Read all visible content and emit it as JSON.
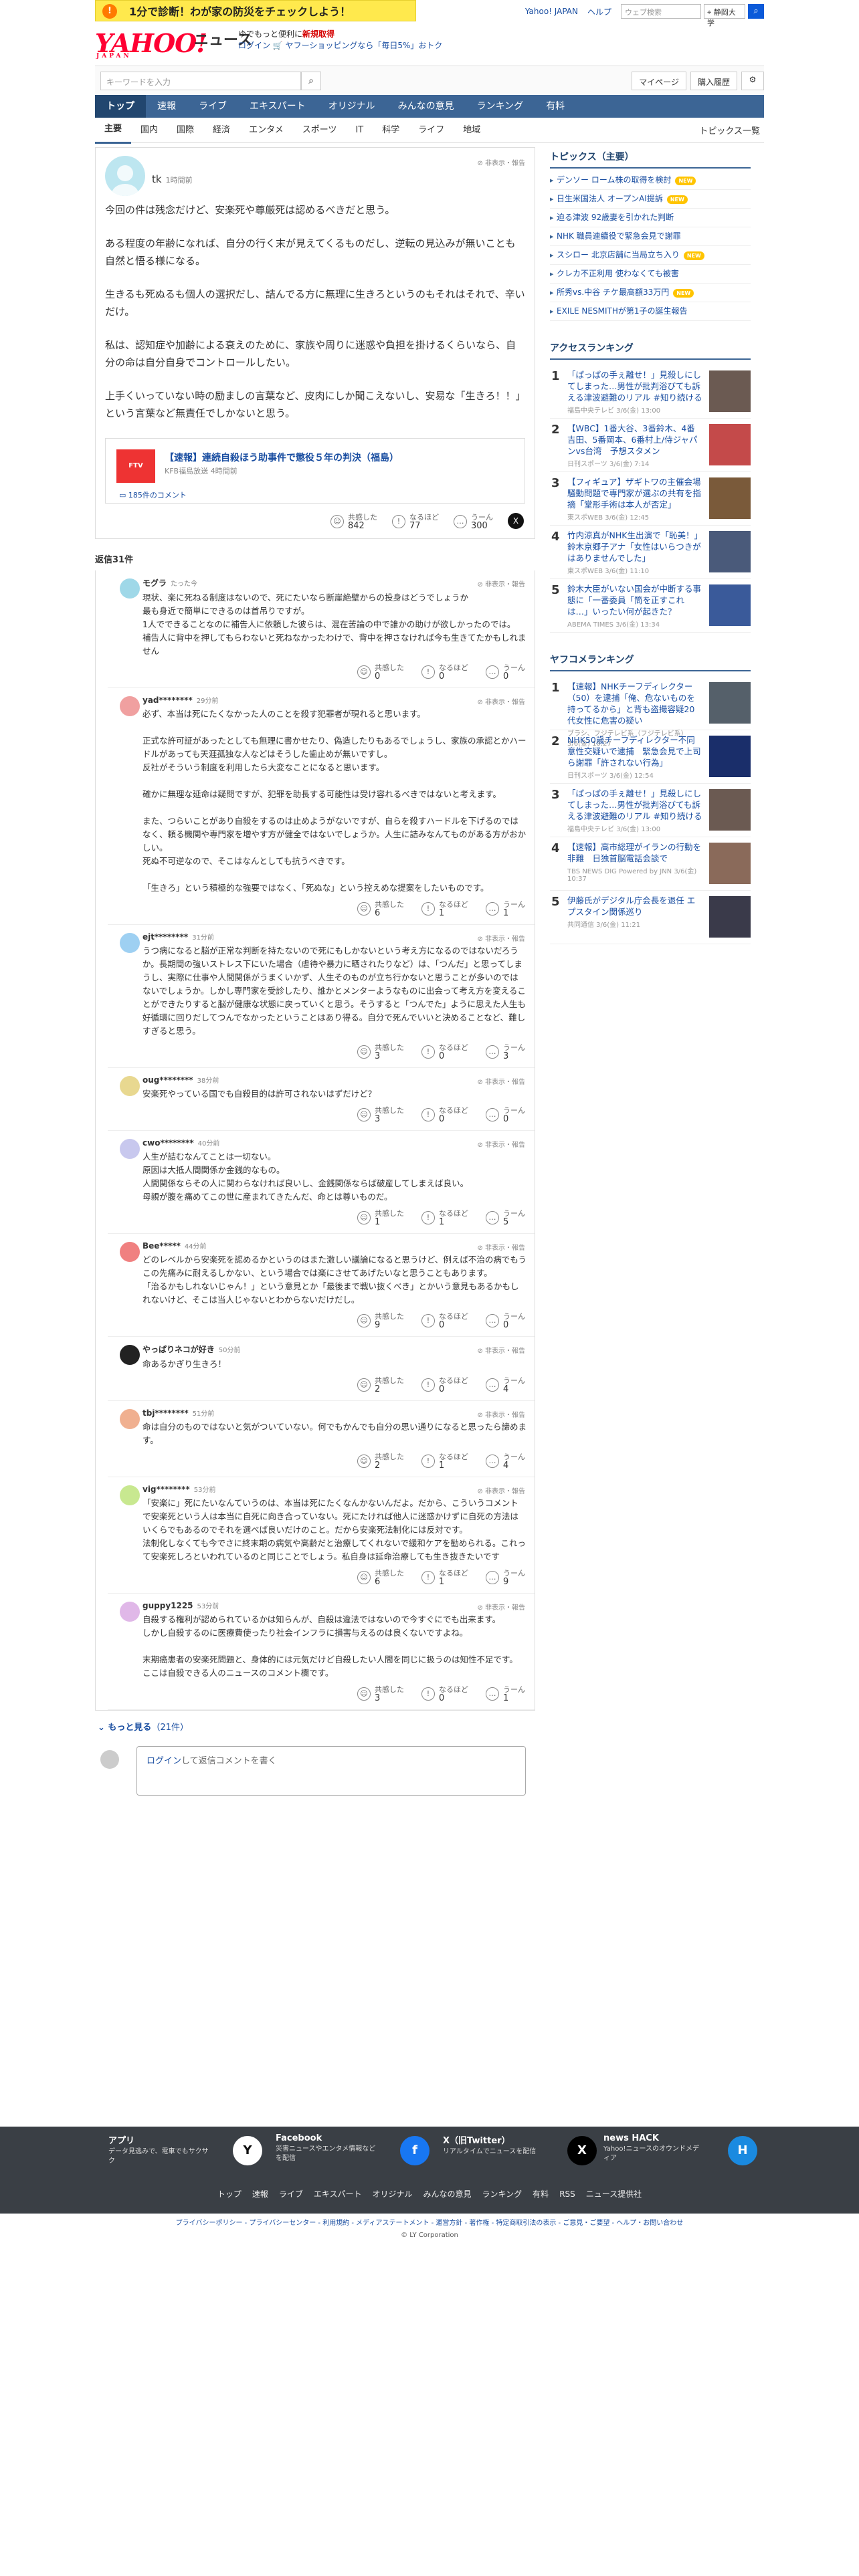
{
  "banner": {
    "text": "1分で診断！わが家の防災をチェックしよう！",
    "icon": "!"
  },
  "topbar": {
    "yahoo_japan": "Yahoo! JAPAN",
    "help": "ヘルプ",
    "search_placeholder": "ウェブ検索",
    "location": "静岡大学"
  },
  "brand": {
    "logo": "YAHOO!",
    "logo_sub": "JAPAN",
    "section": "ニュース"
  },
  "promo": {
    "line1_a": "ゆでもっと便利に",
    "line1_b": "新規取得",
    "line2_a": "ログイン",
    "line2_b": "ヤフーショッピングなら「毎日5%」おトク"
  },
  "search": {
    "placeholder": "キーワードを入力",
    "mypage": "マイページ",
    "history": "購入履歴"
  },
  "nav": [
    "トップ",
    "速報",
    "ライブ",
    "エキスパート",
    "オリジナル",
    "みんなの意見",
    "ランキング",
    "有料"
  ],
  "subnav": [
    "主要",
    "国内",
    "国際",
    "経済",
    "エンタメ",
    "スポーツ",
    "IT",
    "科学",
    "ライフ",
    "地域"
  ],
  "subnav_right": "トピックス一覧",
  "comment": {
    "author": "tk",
    "time": "1時間前",
    "report": "非表示・報告",
    "paragraphs": [
      "今回の件は残念だけど、安楽死や尊厳死は認めるべきだと思う。",
      "ある程度の年齢になれば、自分の行く末が見えてくるものだし、逆転の見込みが無いことも自然と悟る様になる。",
      "生きるも死ぬるも個人の選択だし、詰んでる方に無理に生きろというのもそれはそれで、辛いだけ。",
      "私は、認知症や加齢による衰えのために、家族や周りに迷惑や負担を掛けるくらいなら、自分の命は自分自身でコントロールしたい。",
      "上手くいっていない時の励ましの言葉など、皮肉にしか聞こえないし、安易な「生きろ！！」という言葉など無責任でしかないと思う。"
    ],
    "article": {
      "title": "【速報】連続自殺ほう助事件で懲役５年の判決（福島）",
      "source": "KFB福島放送 4時間前",
      "thumb": "FTV",
      "comments": "185件のコメント"
    },
    "reactions": {
      "empathy": "共感した",
      "empathy_n": "842",
      "naruhodo": "なるほど",
      "naruhodo_n": "77",
      "uun": "うーん",
      "uun_n": "300"
    }
  },
  "replies_label": "返信",
  "replies_count": "31件",
  "replies": [
    {
      "name": "モグラ",
      "time": "たった今",
      "color": "#9fd8e8",
      "text": "現状、楽に死ねる制度はないので、死にたいなら断崖絶壁からの投身はどうでしょうか\n最も身近で簡単にできるのは首吊りですが。\n1人でできることなのに補告人に依頼した彼らは、混在苦論の中で誰かの助けが欲しかったのでは。\n補告人に背中を押してもらわないと死ねなかったわけで、背中を押さなければ今も生きてたかもしれません",
      "r": [
        "0",
        "0",
        "0"
      ]
    },
    {
      "name": "yad********",
      "time": "29分前",
      "color": "#f0a0a0",
      "text": "必ず、本当は死にたくなかった人のことを殺す犯罪者が現れると思います。\n\n正式な許可証があったとしても無理に書かせたり、偽造したりもあるでしょうし、家族の承認とかハードルがあっても天涯孤独な人などはそうした歯止めが無いですし。\n反社がそういう制度を利用したら大変なことになると思います。\n\n確かに無理な延命は疑問ですが、犯罪を助長する可能性は受け容れるべきではないと考えます。\n\nまた、つらいことがあり自殺をするのは止めようがないですが、自らを殺すハードルを下げるのではなく、頼る機関や専門家を増やす方が健全ではないでしょうか。人生に詰みなんてものがある方がおかしい。\n死ぬ不可逆なので、そこはなんとしても抗うべきです。\n\n「生きろ」という積極的な強要ではなく、「死ぬな」という控えめな提案をしたいものです。",
      "r": [
        "6",
        "1",
        "1"
      ]
    },
    {
      "name": "ejt********",
      "time": "31分前",
      "color": "#9ed0f2",
      "text": "うつ病になると脳が正常な判断を持たないので死にもしかないという考え方になるのではないだろうか。長期間の強いストレス下にいた場合（虐待や暴力に晒されたりなど）は、「つんだ」と思ってしまうし、実際に仕事や人間関係がうまくいかず、人生そのものが立ち行かないと思うことが多いのではないでしょうか。しかし専門家を受診したり、誰かとメンターようなものに出会って考え方を変えることができたりすると脳が健康な状態に戻っていくと思う。そうすると「つんでた」ように思えた人生も好循環に回りだしてつんでなかったということはあり得る。自分で死んでいいと決めることなど、難しすぎると思う。",
      "r": [
        "3",
        "0",
        "3"
      ]
    },
    {
      "name": "oug********",
      "time": "38分前",
      "color": "#e8d890",
      "text": "安楽死やっている国でも自殺目的は許可されないはずだけど？",
      "r": [
        "3",
        "0",
        "0"
      ]
    },
    {
      "name": "cwo********",
      "time": "40分前",
      "color": "#c8c8ee",
      "text": "人生が詰むなんてことは一切ない。\n原因は大抵人間関係か金銭的なもの。\n人間関係ならその人に関わらなければ良いし、金銭関係ならば破産してしまえば良い。\n母親が腹を痛めてこの世に産まれてきたんだ、命とは尊いものだ。",
      "r": [
        "1",
        "1",
        "5"
      ]
    },
    {
      "name": "Bee*****",
      "time": "44分前",
      "color": "#f08080",
      "text": "どのレベルから安楽死を認めるかというのはまた激しい議論になると思うけど、例えば不治の病でもうこの先痛みに耐えるしかない、という場合では楽にさせてあげたいなと思うこともあります。\n「治るかもしれないじゃん！」という意見とか「最後まで戦い抜くべき」とかいう意見もあるかもしれないけど、そこは当人じゃないとわからないだけだし。",
      "r": [
        "9",
        "0",
        "0"
      ]
    },
    {
      "name": "やっぱりネコが好き",
      "time": "50分前",
      "color": "#222222",
      "text": "命あるかぎり生きろ！",
      "r": [
        "2",
        "0",
        "4"
      ]
    },
    {
      "name": "tbj********",
      "time": "51分前",
      "color": "#f0b090",
      "text": "命は自分のものではないと気がついていない。何でもかんでも自分の思い通りになると思ったら諦めます。",
      "r": [
        "2",
        "1",
        "4"
      ]
    },
    {
      "name": "vig********",
      "time": "53分前",
      "color": "#c8e890",
      "text": "「安楽に」死にたいなんていうのは、本当は死にたくなんかないんだよ。だから、こういうコメントで安楽死という人は本当に自死に向き合っていない。死にたければ他人に迷惑かけずに自死の方法はいくらでもあるのでそれを選べば良いだけのこと。だから安楽死法制化には反対です。\n法制化しなくても今でさに終末期の病気や高齢だと治療してくれないで緩和ケアを勧められる。これって安楽死しろといわれているのと同じことでしょう。私自身は延命治療しても生き抜きたいです",
      "r": [
        "6",
        "1",
        "9"
      ]
    },
    {
      "name": "guppy1225",
      "time": "53分前",
      "color": "#e0b8e8",
      "text": "自殺する権利が認められているかは知らんが、自殺は違法ではないので今すぐにでも出来ます。\nしかし自殺するのに医療費使ったり社会インフラに損害与えるのは良くないですよね。\n\n末期癌患者の安楽死問題と、身体的には元気だけど自殺したい人間を同じに扱うのは知性不足です。\nここは自殺できる人のニュースのコメント欄です。",
      "r": [
        "3",
        "0",
        "1"
      ]
    }
  ],
  "more": {
    "label": "もっと見る",
    "count": "（21件）"
  },
  "compose": {
    "login": "ログイン",
    "rest": "して返信コメントを書く"
  },
  "topics": {
    "title": "トピックス（主要）",
    "items": [
      {
        "t": "デンソー ローム株の取得を検討",
        "b": "NEW"
      },
      {
        "t": "日生米国法人 オープンAI提訴",
        "b": "NEW"
      },
      {
        "t": "迫る津波 92歳妻を引かれた判断",
        "b": ""
      },
      {
        "t": "NHK 職員連續役で緊急会見で謝罪",
        "b": ""
      },
      {
        "t": "スシロー 北京店舗に当局立ち入り",
        "b": "NEW"
      },
      {
        "t": "クレカ不正利用 使わなくても被害",
        "b": ""
      },
      {
        "t": "所秀vs.中谷 チケ最高額33万円",
        "b": "NEW"
      },
      {
        "t": "EXILE NESMITHが第1子の誕生報告",
        "b": ""
      }
    ]
  },
  "access": {
    "title": "アクセスランキング",
    "items": [
      {
        "t": "「ぱっぱの手ぇ離せ！」見殺しにしてしまった…男性が批判浴びても訴える津波避難のリアル #知り続ける",
        "s": "福島中央テレビ 3/6(金) 13:00"
      },
      {
        "t": "【WBC】1番大谷、3番鈴木、4番吉田、5番岡本、6番村上/侍ジャパンvs台湾　予想スタメン",
        "s": "日刊スポーツ 3/6(金) 7:14"
      },
      {
        "t": "【フィギュア】ザギトワの主催会場騒動問題で専門家が選ぶの共有を指摘「堂形手術は本人が否定」",
        "s": "東スポWEB 3/6(金) 12:45"
      },
      {
        "t": "竹内涼真がNHK生出演で「恥美！」鈴木京郷子アナ「女性はいらつきがはありませんでした」",
        "s": "東スポWEB 3/6(金) 11:10"
      },
      {
        "t": "鈴木大臣がいない国会が中断する事態に「一番委員「筒を正すこれは…」いったい何が起きた？",
        "s": "ABEMA TIMES 3/6(金) 13:34"
      }
    ]
  },
  "yafuko": {
    "title": "ヤフコメランキング",
    "items": [
      {
        "t": "【速報】NHKチーフディレクター（50）を逮捕「俺、危ないものを持ってるから」と背も盗撮容疑20代女性に危害の疑い",
        "s": "ブラシ、フジテレビ系（フジテレビ系） 3/6(金) 10:27"
      },
      {
        "t": "NHK50歳チーフディレクター不同意性交疑いで逮捕　緊急会見で上司ら謝罪「許されない行為」",
        "s": "日刊スポーツ 3/6(金) 12:54"
      },
      {
        "t": "「ぱっぱの手ぇ離せ！」見殺しにしてしまった…男性が批判浴びても訴える津波避難のリアル #知り続ける",
        "s": "福島中央テレビ 3/6(金) 13:00"
      },
      {
        "t": "【速報】高市総理がイランの行動を非難　日独首脳電話会談で",
        "s": "TBS NEWS DIG Powered by JNN 3/6(金) 10:37"
      },
      {
        "t": "伊藤氏がデジタル庁会長を退任 エプスタイン関係巡り",
        "s": "共同通信 3/6(金) 11:21"
      }
    ]
  },
  "footer": {
    "cols": [
      {
        "t": "アプリ",
        "d": "データ見逃みで、電車でもサクサク",
        "i": "Y"
      },
      {
        "t": "Facebook",
        "d": "災害ニュースやエンタメ情報などを配信",
        "i": "f"
      },
      {
        "t": "X（旧Twitter）",
        "d": "リアルタイムでニュースを配信",
        "i": "X"
      },
      {
        "t": "news HACK",
        "d": "Yahoo!ニュースのオウンドメディア",
        "i": "H"
      }
    ],
    "links": [
      "トップ",
      "速報",
      "ライブ",
      "エキスパート",
      "オリジナル",
      "みんなの意見",
      "ランキング",
      "有料",
      "RSS",
      "ニュース提供社"
    ]
  },
  "legal": {
    "links": "プライバシーポリシー - プライバシーセンター - 利用規約 - メディアステートメント - 運営方針 - 著作権 - 特定商取引法の表示 - ご意見・ご要望 - ヘルプ・お問い合わせ",
    "copy": "© LY Corporation"
  }
}
